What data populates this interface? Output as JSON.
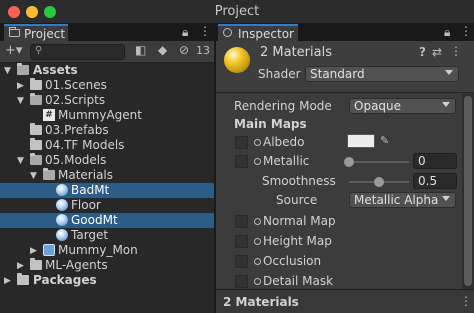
{
  "window": {
    "title": "Project"
  },
  "colors": {
    "selection": "#2c5d87",
    "tab_accent": "#3a79bb",
    "material_sphere": "#f2c428"
  },
  "project": {
    "tab_label": "Project",
    "toolbar": {
      "add_label": "+▾",
      "hidden_count": "13"
    },
    "tree": [
      {
        "label": "Assets",
        "icon": "folder-icon",
        "bold": true
      },
      {
        "label": "01.Scenes",
        "icon": "folder-icon"
      },
      {
        "label": "02.Scripts",
        "icon": "folder-icon"
      },
      {
        "label": "MummyAgent",
        "icon": "script-icon"
      },
      {
        "label": "03.Prefabs",
        "icon": "folder-icon"
      },
      {
        "label": "04.TF Models",
        "icon": "folder-icon"
      },
      {
        "label": "05.Models",
        "icon": "folder-icon"
      },
      {
        "label": "Materials",
        "icon": "folder-icon"
      },
      {
        "label": "BadMt",
        "icon": "material-icon",
        "selected": true
      },
      {
        "label": "Floor",
        "icon": "material-icon"
      },
      {
        "label": "GoodMt",
        "icon": "material-icon",
        "selected": true
      },
      {
        "label": "Target",
        "icon": "material-icon"
      },
      {
        "label": "Mummy_Mon",
        "icon": "prefab-icon"
      },
      {
        "label": "ML-Agents",
        "icon": "folder-icon"
      },
      {
        "label": "Packages",
        "icon": "folder-icon",
        "bold": true
      }
    ]
  },
  "inspector": {
    "tab_label": "Inspector",
    "header": {
      "title": "2 Materials",
      "shader_label": "Shader",
      "shader_value": "Standard"
    },
    "rendering_mode": {
      "label": "Rendering Mode",
      "value": "Opaque"
    },
    "main_maps": {
      "heading": "Main Maps",
      "albedo": {
        "label": "Albedo",
        "color": "#ececec"
      },
      "metallic": {
        "label": "Metallic",
        "value": "0",
        "level": 0.0
      },
      "smoothness": {
        "label": "Smoothness",
        "value": "0.5",
        "level": 0.5
      },
      "source": {
        "label": "Source",
        "value": "Metallic Alpha"
      },
      "normal_map": {
        "label": "Normal Map"
      },
      "height_map": {
        "label": "Height Map"
      },
      "occlusion": {
        "label": "Occlusion"
      },
      "detail_mask": {
        "label": "Detail Mask"
      }
    },
    "footer": {
      "label": "2 Materials"
    }
  }
}
